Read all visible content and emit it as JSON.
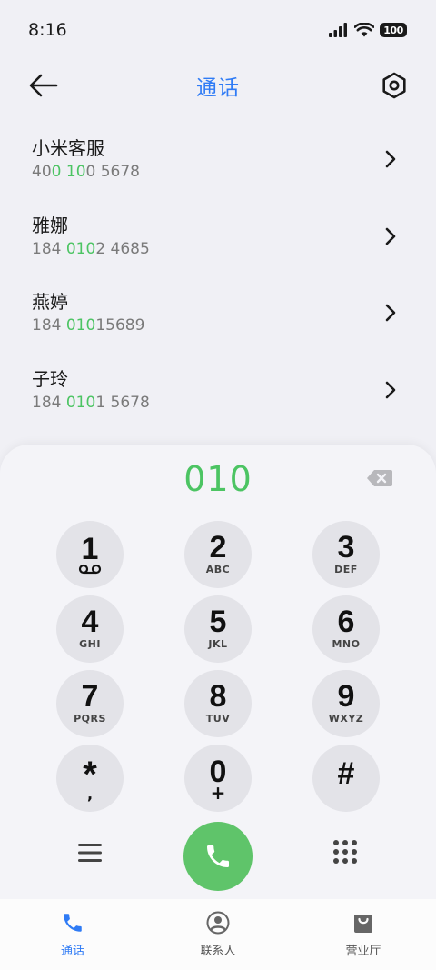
{
  "status_bar": {
    "time": "8:16",
    "battery": "100"
  },
  "header": {
    "title": "通话",
    "back_icon": "arrow-left-icon",
    "settings_icon": "hexagon-settings-icon"
  },
  "contacts": [
    {
      "name": "小米客服",
      "number_parts": [
        "40",
        "0",
        " ",
        "10",
        "0 5678"
      ]
    },
    {
      "name": "雅娜",
      "number_parts": [
        "184 ",
        "010",
        "2 4685"
      ]
    },
    {
      "name": "燕婷",
      "number_parts": [
        "184 ",
        "010",
        "15689"
      ]
    },
    {
      "name": "子玲",
      "number_parts": [
        "184 ",
        "010",
        "1 5678"
      ]
    }
  ],
  "dialer": {
    "display": "010",
    "keys": [
      {
        "digit": "1",
        "letters": ""
      },
      {
        "digit": "2",
        "letters": "ABC"
      },
      {
        "digit": "3",
        "letters": "DEF"
      },
      {
        "digit": "4",
        "letters": "GHI"
      },
      {
        "digit": "5",
        "letters": "JKL"
      },
      {
        "digit": "6",
        "letters": "MNO"
      },
      {
        "digit": "7",
        "letters": "PQRS"
      },
      {
        "digit": "8",
        "letters": "TUV"
      },
      {
        "digit": "9",
        "letters": "WXYZ"
      },
      {
        "digit": "*",
        "letters": ","
      },
      {
        "digit": "0",
        "letters": "+"
      },
      {
        "digit": "#",
        "letters": ""
      }
    ]
  },
  "tabs": [
    {
      "label": "通话",
      "icon": "phone-icon",
      "active": true
    },
    {
      "label": "联系人",
      "icon": "person-icon",
      "active": false
    },
    {
      "label": "营业厅",
      "icon": "bag-icon",
      "active": false
    }
  ],
  "colors": {
    "accent_blue": "#2f7bf5",
    "match_green": "#4cc463",
    "call_green": "#5fc46a"
  }
}
